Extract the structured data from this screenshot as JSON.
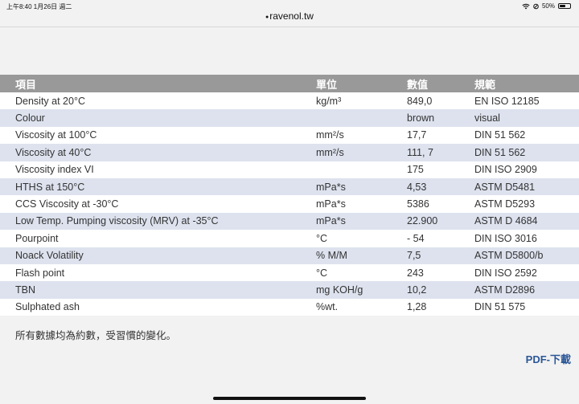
{
  "status_bar": {
    "time_date": "上午8:40   1月26日 週二",
    "battery_percent": "50%",
    "icons": [
      "wifi-icon",
      "location-icon",
      "battery-icon"
    ]
  },
  "browser": {
    "url": "ravenol.tw",
    "lock_icon": "lock-icon"
  },
  "table": {
    "headers": [
      "項目",
      "單位",
      "數值",
      "規範"
    ],
    "rows": [
      [
        "Density at 20°C",
        "kg/m³",
        "849,0",
        "EN ISO 12185"
      ],
      [
        "Colour",
        "",
        "brown",
        "visual"
      ],
      [
        "Viscosity at 100°C",
        "mm²/s",
        "17,7",
        "DIN 51 562"
      ],
      [
        "Viscosity at 40°C",
        "mm²/s",
        "111, 7",
        "DIN 51 562"
      ],
      [
        "Viscosity index VI",
        "",
        "175",
        "DIN ISO 2909"
      ],
      [
        "HTHS at 150°C",
        "mPa*s",
        "4,53",
        "ASTM D5481"
      ],
      [
        "CCS Viscosity at -30°C",
        "mPa*s",
        "5386",
        "ASTM D5293"
      ],
      [
        "Low Temp. Pumping viscosity (MRV) at -35°C",
        "mPa*s",
        "22.900",
        "ASTM D 4684"
      ],
      [
        "Pourpoint",
        "°C",
        "- 54",
        "DIN ISO 3016"
      ],
      [
        "Noack Volatility",
        "% M/M",
        "7,5",
        "ASTM D5800/b"
      ],
      [
        "Flash point",
        "°C",
        "243",
        "DIN ISO 2592"
      ],
      [
        "TBN",
        "mg KOH/g",
        "10,2",
        "ASTM D2896"
      ],
      [
        "Sulphated ash",
        "%wt.",
        "1,28",
        "DIN 51 575"
      ]
    ]
  },
  "footnote": "所有數據均為約數，受習慣的變化。",
  "pdf_link": "PDF-下載",
  "colors": {
    "header_bg": "#999999",
    "row_alt_bg": "#dde2ee",
    "link": "#2b5797"
  }
}
